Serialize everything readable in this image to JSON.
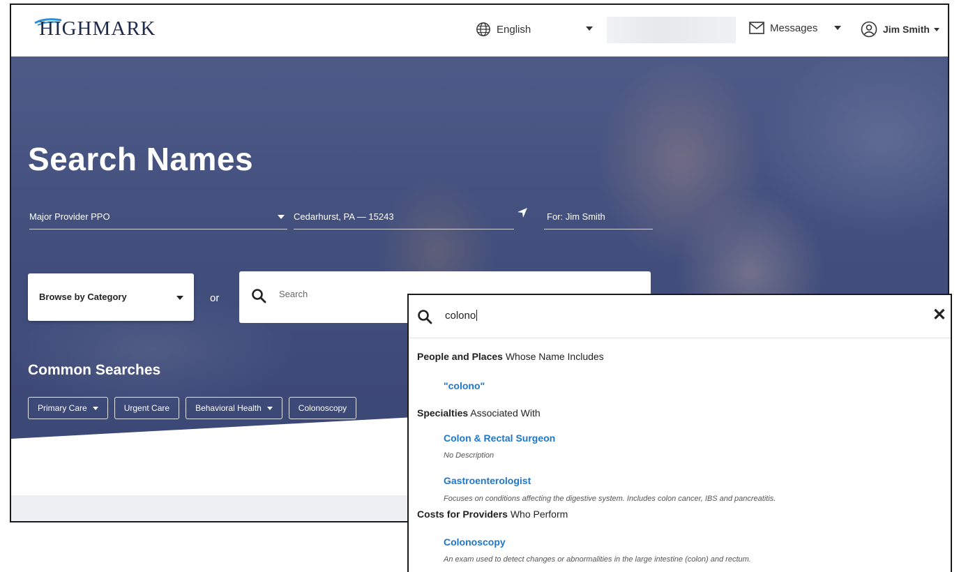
{
  "header": {
    "logo_text": "HIGHMARK",
    "language_label": "English",
    "messages_label": "Messages",
    "user_name": "Jim Smith"
  },
  "hero": {
    "title": "Search Names",
    "plan": "Major Provider PPO",
    "location": "Cedarhurst, PA — 15243",
    "for_label": "For: Jim Smith",
    "browse_label": "Browse by Category",
    "or_label": "or",
    "search_placeholder": "Search",
    "common_title": "Common Searches",
    "chips": [
      "Primary Care",
      "Urgent Care",
      "Behavioral Health",
      "Colonoscopy"
    ]
  },
  "dropdown": {
    "query": "colono",
    "sections": [
      {
        "bold": "People and Places",
        "rest": " Whose Name Includes",
        "items": [
          {
            "label": "\"colono\"",
            "desc": ""
          }
        ]
      },
      {
        "bold": "Specialties",
        "rest": " Associated With",
        "items": [
          {
            "label": "Colon & Rectal Surgeon",
            "desc": "No Description"
          },
          {
            "label": "Gastroenterologist",
            "desc": "Focuses on conditions affecting the digestive system. Includes colon cancer, IBS and pancreatitis."
          }
        ]
      },
      {
        "bold": "Costs for Providers",
        "rest": " Who Perform",
        "items": [
          {
            "label": "Colonoscopy",
            "desc": "An exam used to detect changes or abnormalities in the large intestine (colon) and rectum."
          }
        ]
      }
    ]
  },
  "colors": {
    "link_blue": "#1d77c9",
    "hero_overlay": "#4a5785",
    "logo_navy": "#1f2a4b",
    "logo_accent": "#2a8fd6"
  },
  "icons": [
    "logo-swoosh-icon",
    "globe-icon",
    "envelope-icon",
    "user-circle-icon",
    "location-arrow-icon",
    "search-icon",
    "close-icon"
  ]
}
